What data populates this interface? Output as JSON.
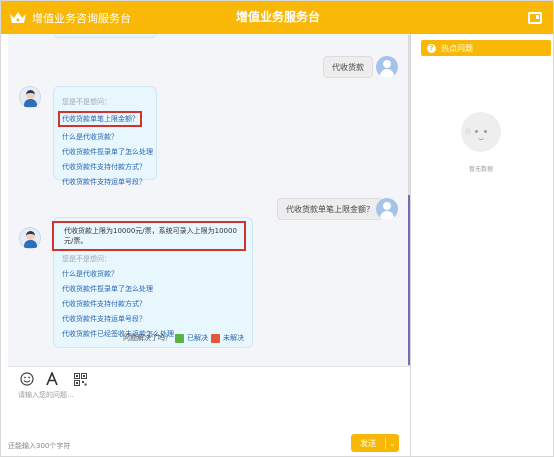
{
  "header": {
    "brand_name": "增值业务咨询服务台",
    "title": "增值业务服务台",
    "brand_color": "#f9b807"
  },
  "chat": {
    "messages": [
      {
        "from": "user",
        "text": "代收货款"
      },
      {
        "from": "agent",
        "heading": "您是不是想问：",
        "links": [
          "代收货款单笔上限金额？",
          "什么是代收货款？",
          "代收货款件揽录单了怎么处理",
          "代收货款件支持付款方式？",
          "代收货款件支持运单号段？"
        ]
      },
      {
        "from": "user",
        "text": "代收货款单笔上限金额？"
      },
      {
        "from": "agent",
        "answer": "代收货款上限为10000元/票，系统可录入上限为10000元/票。",
        "heading": "您是不是想问：",
        "links": [
          "什么是代收货款？",
          "代收货款件揽录单了怎么处理",
          "代收货款件支持付款方式？",
          "代收货款件支持运单号段？",
          "代收货款件已经签收未返款怎么处理"
        ],
        "feedback": {
          "question": "问题解决了吗？",
          "solved": "已解决",
          "unsolved": "未解决"
        }
      }
    ]
  },
  "composer": {
    "placeholder": "请输入您的问题...",
    "footer_text": "还能输入300个字符",
    "send_label": "发送",
    "tools": [
      "emoji-icon",
      "font-icon",
      "qrcode-icon"
    ]
  },
  "sidebar": {
    "title": "热点问题",
    "empty_text": "暂无数据"
  }
}
